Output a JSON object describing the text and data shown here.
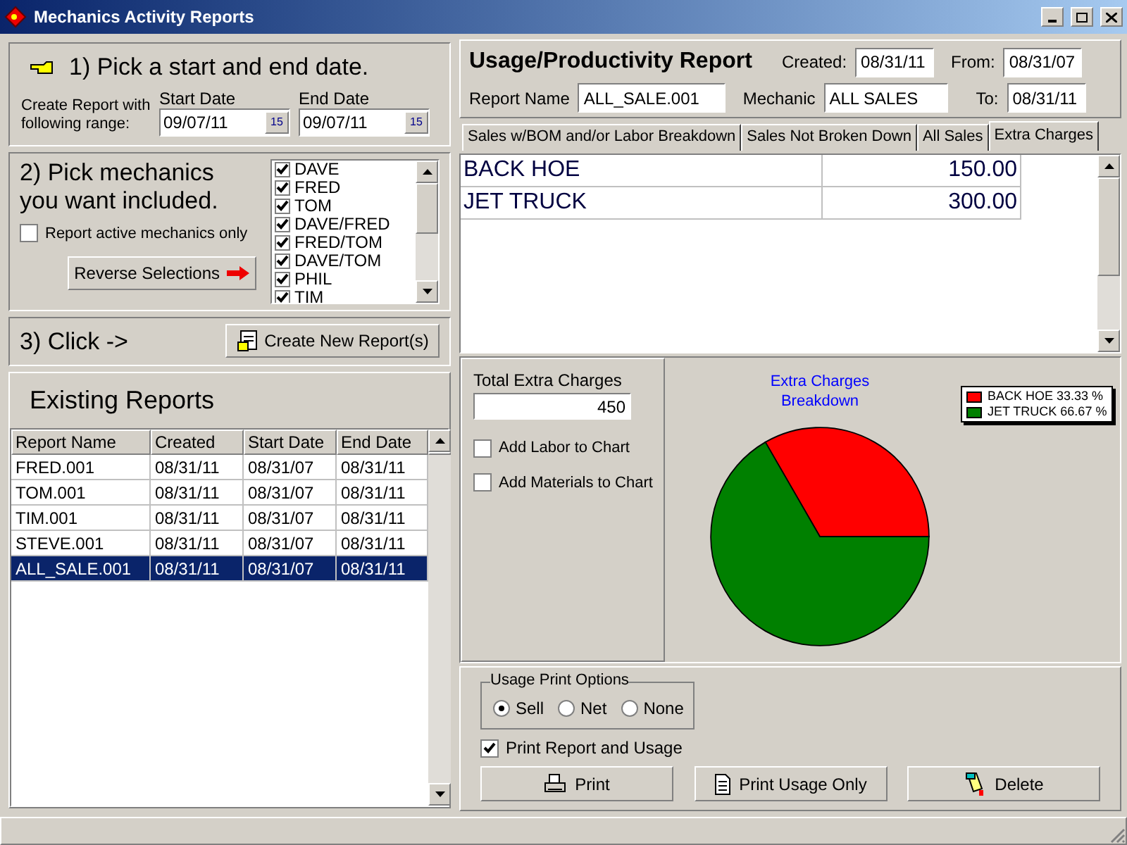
{
  "window": {
    "title": "Mechanics Activity Reports"
  },
  "step1": {
    "heading": "1) Pick a start and end date.",
    "range_label": "Create Report with following range:",
    "start": {
      "label": "Start Date",
      "value": "09/07/11",
      "calendar": "15"
    },
    "end": {
      "label": "End Date",
      "value": "09/07/11",
      "calendar": "15"
    }
  },
  "step2": {
    "heading": "2) Pick mechanics you want included.",
    "active_only": {
      "label": "Report active mechanics only",
      "checked": false
    },
    "reverse_button": "Reverse Selections",
    "mechanics": [
      {
        "name": "DAVE",
        "checked": true
      },
      {
        "name": "FRED",
        "checked": true
      },
      {
        "name": "TOM",
        "checked": true
      },
      {
        "name": "DAVE/FRED",
        "checked": true
      },
      {
        "name": "FRED/TOM",
        "checked": true
      },
      {
        "name": "DAVE/TOM",
        "checked": true
      },
      {
        "name": "PHIL",
        "checked": true
      },
      {
        "name": "TIM",
        "checked": true
      }
    ]
  },
  "step3": {
    "label": "3) Click ->",
    "button": "Create New Report(s)"
  },
  "existing_reports": {
    "title": "Existing Reports",
    "columns": [
      "Report Name",
      "Created",
      "Start Date",
      "End Date"
    ],
    "rows": [
      {
        "cells": [
          "FRED.001",
          "08/31/11",
          "08/31/07",
          "08/31/11"
        ],
        "selected": false
      },
      {
        "cells": [
          "TOM.001",
          "08/31/11",
          "08/31/07",
          "08/31/11"
        ],
        "selected": false
      },
      {
        "cells": [
          "TIM.001",
          "08/31/11",
          "08/31/07",
          "08/31/11"
        ],
        "selected": false
      },
      {
        "cells": [
          "STEVE.001",
          "08/31/11",
          "08/31/07",
          "08/31/11"
        ],
        "selected": false
      },
      {
        "cells": [
          "ALL_SALE.001",
          "08/31/11",
          "08/31/07",
          "08/31/11"
        ],
        "selected": true
      }
    ]
  },
  "report": {
    "title": "Usage/Productivity Report",
    "created": {
      "label": "Created:",
      "value": "08/31/11"
    },
    "from": {
      "label": "From:",
      "value": "08/31/07"
    },
    "report_name": {
      "label": "Report Name",
      "value": "ALL_SALE.001"
    },
    "mechanic": {
      "label": "Mechanic",
      "value": "ALL SALES"
    },
    "to": {
      "label": "To:",
      "value": "08/31/11"
    }
  },
  "tabs": [
    {
      "label": "Sales w/BOM and/or Labor Breakdown",
      "selected": false
    },
    {
      "label": "Sales Not Broken Down",
      "selected": false
    },
    {
      "label": "All Sales",
      "selected": false
    },
    {
      "label": "Extra Charges",
      "selected": true
    }
  ],
  "charges": [
    {
      "name": "BACK HOE",
      "amount": "150.00"
    },
    {
      "name": "JET TRUCK",
      "amount": "300.00"
    }
  ],
  "total": {
    "label": "Total Extra Charges",
    "value": "450"
  },
  "chart_options": [
    {
      "label": "Add Labor to Chart",
      "checked": false
    },
    {
      "label": "Add Materials to Chart",
      "checked": false
    }
  ],
  "chart_data": {
    "type": "pie",
    "title": "Extra Charges Breakdown",
    "categories": [
      "BACK HOE 33.33 %",
      "JET TRUCK 66.67 %"
    ],
    "series": [
      {
        "values": [
          33.33,
          66.67
        ]
      }
    ],
    "colors": [
      "#ff0000",
      "#008000"
    ]
  },
  "print_options": {
    "title": "Usage Print Options",
    "options": [
      {
        "label": "Sell",
        "selected": true
      },
      {
        "label": "Net",
        "selected": false
      },
      {
        "label": "None",
        "selected": false
      }
    ],
    "print_both": {
      "label": "Print Report and Usage",
      "checked": true
    }
  },
  "buttons": [
    {
      "kind": "print",
      "label": "Print"
    },
    {
      "kind": "usage",
      "label": "Print Usage Only"
    },
    {
      "kind": "delete",
      "label": "Delete"
    }
  ]
}
